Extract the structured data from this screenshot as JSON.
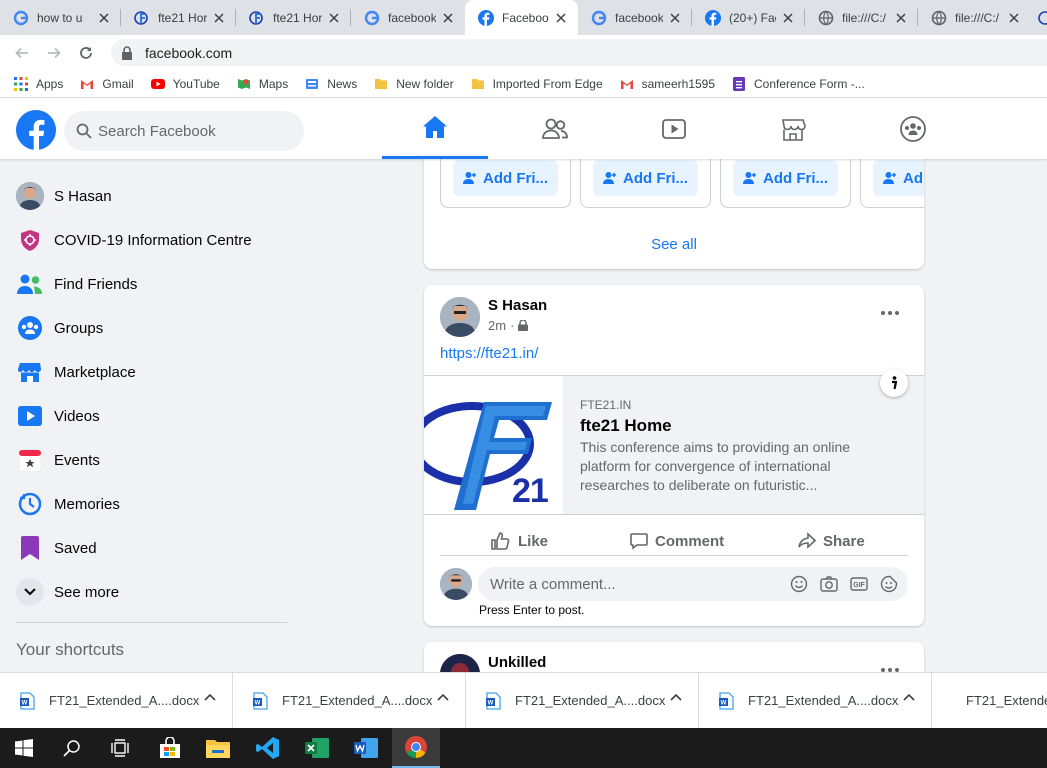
{
  "browser": {
    "tabs": [
      {
        "title": "how to u",
        "favicon": "google-icon"
      },
      {
        "title": "fte21 Hor",
        "favicon": "fte21-icon"
      },
      {
        "title": "fte21 Hor",
        "favicon": "fte21-icon"
      },
      {
        "title": "facebook",
        "favicon": "google-icon"
      },
      {
        "title": "Facebook",
        "favicon": "facebook-icon",
        "active": true
      },
      {
        "title": "facebook",
        "favicon": "google-icon"
      },
      {
        "title": "(20+) Fac",
        "favicon": "facebook-icon"
      },
      {
        "title": "file:///C:/",
        "favicon": "globe-icon"
      },
      {
        "title": "file:///C:/",
        "favicon": "globe-icon"
      }
    ],
    "url": "facebook.com",
    "bookmarks": [
      {
        "label": "Apps",
        "icon": "apps-grid-icon"
      },
      {
        "label": "Gmail",
        "icon": "gmail-icon"
      },
      {
        "label": "YouTube",
        "icon": "youtube-icon"
      },
      {
        "label": "Maps",
        "icon": "maps-icon"
      },
      {
        "label": "News",
        "icon": "news-icon"
      },
      {
        "label": "New folder",
        "icon": "folder-icon"
      },
      {
        "label": "Imported From Edge",
        "icon": "folder-icon"
      },
      {
        "label": "sameerh1595",
        "icon": "gmail-icon"
      },
      {
        "label": "Conference Form -...",
        "icon": "forms-icon"
      }
    ]
  },
  "header": {
    "search_placeholder": "Search Facebook",
    "nav_tabs": [
      "home-icon",
      "friends-icon",
      "watch-icon",
      "marketplace-icon",
      "groups-icon"
    ]
  },
  "sidebar": {
    "items": [
      {
        "label": "S Hasan",
        "icon": "avatar"
      },
      {
        "label": "COVID-19 Information Centre",
        "icon": "covid-shield-icon"
      },
      {
        "label": "Find Friends",
        "icon": "friends-icon"
      },
      {
        "label": "Groups",
        "icon": "groups-icon"
      },
      {
        "label": "Marketplace",
        "icon": "marketplace-icon"
      },
      {
        "label": "Videos",
        "icon": "videos-icon"
      },
      {
        "label": "Events",
        "icon": "events-icon"
      },
      {
        "label": "Memories",
        "icon": "memories-icon"
      },
      {
        "label": "Saved",
        "icon": "saved-icon"
      },
      {
        "label": "See more",
        "icon": "chevron-down-icon"
      }
    ],
    "shortcuts_title": "Your shortcuts"
  },
  "feed": {
    "pymk": {
      "add_label": "Add Fri...",
      "add_label_cut": "Ad",
      "see_all": "See all"
    },
    "post": {
      "author": "S Hasan",
      "time": "2m",
      "link": "https://fte21.in/",
      "preview": {
        "domain": "FTE21.IN",
        "title": "fte21 Home",
        "description": "This conference aims to providing an online platform for convergence of international researches to deliberate on futuristic...",
        "logo_text": "FT21"
      },
      "actions": {
        "like": "Like",
        "comment": "Comment",
        "share": "Share"
      },
      "comment_placeholder": "Write a comment...",
      "comment_hint": "Press Enter to post."
    },
    "next_post_author": "Unkilled"
  },
  "downloads": [
    {
      "name": "FT21_Extended_A....docx"
    },
    {
      "name": "FT21_Extended_A....docx"
    },
    {
      "name": "FT21_Extended_A....docx"
    },
    {
      "name": "FT21_Extended_A....docx"
    },
    {
      "name": "FT21_Extende"
    }
  ],
  "taskbar": [
    "windows-start-icon",
    "search-icon",
    "task-view-icon",
    "store-icon",
    "file-explorer-icon",
    "vscode-icon",
    "excel-icon",
    "word-icon",
    "chrome-icon"
  ],
  "colors": {
    "fb_blue": "#1877f2",
    "fb_bg": "#f0f2f5",
    "chrome_tabstrip": "#dee1e6"
  }
}
